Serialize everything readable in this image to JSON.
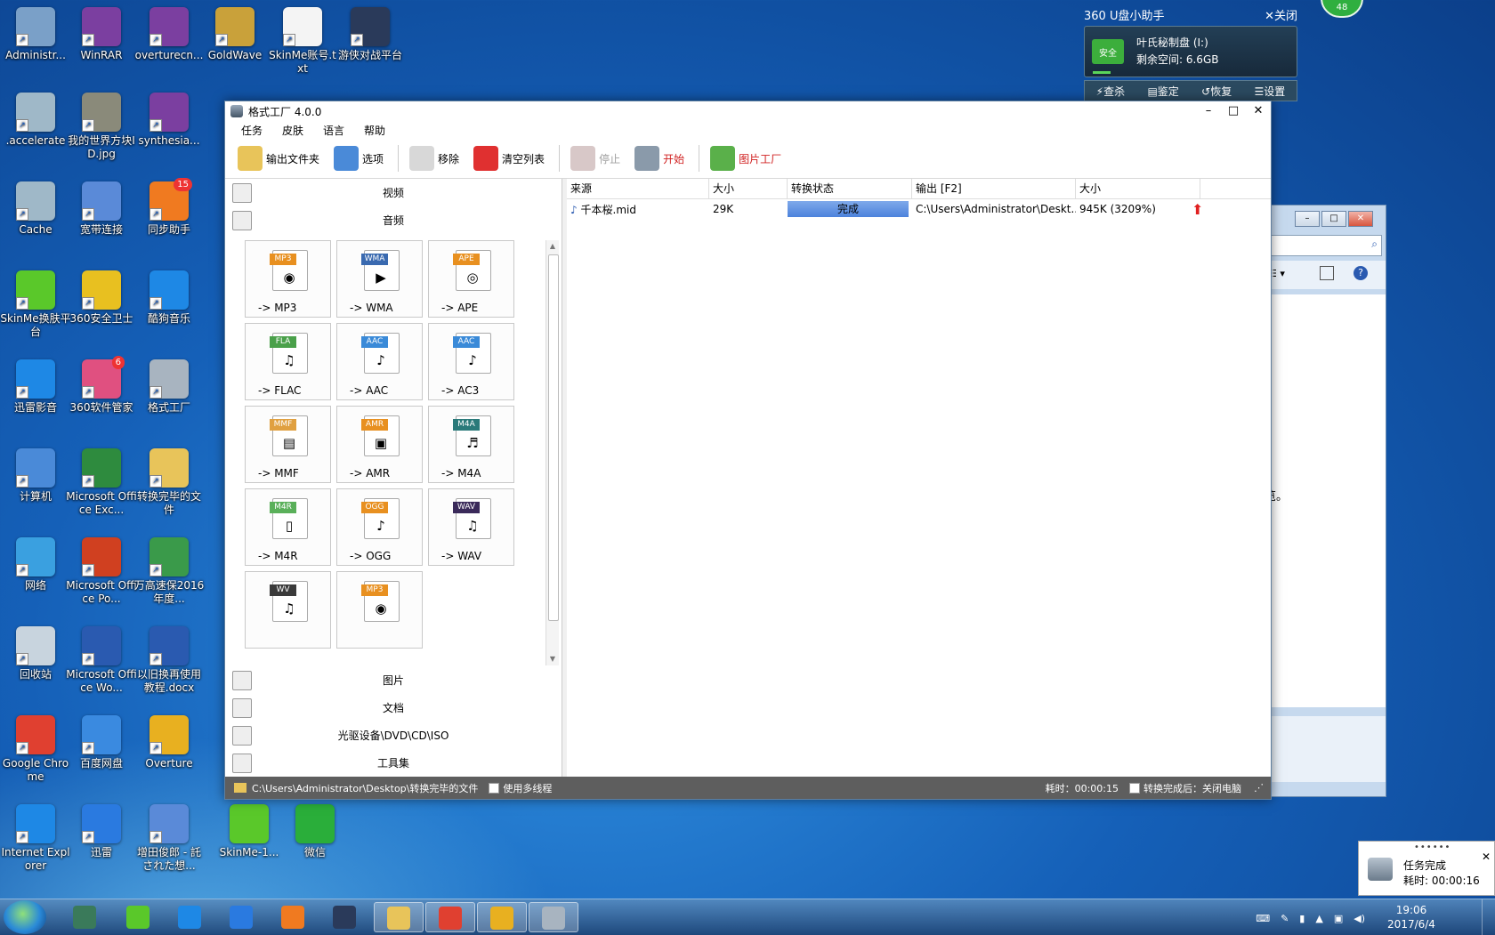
{
  "desktop_icons": [
    {
      "label": "Administr...",
      "color": "#7aa0c8"
    },
    {
      "label": "WinRAR",
      "color": "#7b3fa0"
    },
    {
      "label": "overturecn...",
      "color": "#7b3fa0"
    },
    {
      "label": "GoldWave",
      "color": "#c9a13a"
    },
    {
      "label": "SkinMe账号.txt",
      "color": "#f4f4f4"
    },
    {
      "label": "游侠对战平台",
      "color": "#2a3a5a"
    },
    {
      "label": ".accelerate",
      "color": "#9fb8c8"
    },
    {
      "label": "我的世界方块ID.jpg",
      "color": "#8a8a7a"
    },
    {
      "label": "synthesia...",
      "color": "#7b3fa0"
    },
    {
      "label": "Cache",
      "color": "#9fb8c8"
    },
    {
      "label": "宽带连接",
      "color": "#5a8ad8"
    },
    {
      "label": "同步助手",
      "color": "#f07a20",
      "badge": "15"
    },
    {
      "label": "SkinMe换肤平台",
      "color": "#5ac82a"
    },
    {
      "label": "360安全卫士",
      "color": "#e8c020"
    },
    {
      "label": "酷狗音乐",
      "color": "#1e88e5"
    },
    {
      "label": "迅雷影音",
      "color": "#1e88e5"
    },
    {
      "label": "360软件管家",
      "color": "#e05080",
      "badge": "6"
    },
    {
      "label": "格式工厂",
      "color": "#a8b4c0"
    },
    {
      "label": "计算机",
      "color": "#4a8ad8"
    },
    {
      "label": "Microsoft Office Exc...",
      "color": "#2e8b3e"
    },
    {
      "label": "转换完毕的文件",
      "color": "#e8c45a"
    },
    {
      "label": "网络",
      "color": "#3aa0e0"
    },
    {
      "label": "Microsoft Office Po...",
      "color": "#d04020"
    },
    {
      "label": "万高速保2016年度...",
      "color": "#3a9a4a"
    },
    {
      "label": "回收站",
      "color": "#c8d4de"
    },
    {
      "label": "Microsoft Office Wo...",
      "color": "#2a5ab0"
    },
    {
      "label": "以旧换再使用教程.docx",
      "color": "#2a5ab0"
    },
    {
      "label": "Google Chrome",
      "color": "#e04030"
    },
    {
      "label": "百度网盘",
      "color": "#3a8ae0"
    },
    {
      "label": "Overture",
      "color": "#e8b020"
    },
    {
      "label": "Internet Explorer",
      "color": "#1e88e5"
    },
    {
      "label": "迅雷",
      "color": "#2a7ae0"
    },
    {
      "label": "增田俊郎 - 託された想...",
      "color": "#5a8ad8"
    },
    {
      "label": "SkinMe-1...",
      "color": "#5ac82a"
    },
    {
      "label": "微信",
      "color": "#2aae3a"
    }
  ],
  "u360": {
    "title": "360 U盘小助手",
    "close": "✕关闭",
    "safe": "安全",
    "disk": "叶氏秘制盘 (I:)",
    "space": "剩余空间: 6.6GB",
    "actions": [
      "查杀",
      "鉴定",
      "恢复",
      "设置"
    ],
    "ball": "48"
  },
  "app": {
    "title": "格式工厂 4.0.0",
    "menu": [
      "任务",
      "皮肤",
      "语言",
      "帮助"
    ],
    "toolbar": [
      {
        "label": "输出文件夹",
        "color": "#e8c45a",
        "state": "normal"
      },
      {
        "label": "选项",
        "color": "#4a8ad8",
        "state": "normal"
      },
      {
        "label": "移除",
        "color": "#d8d8d8",
        "state": "normal"
      },
      {
        "label": "清空列表",
        "color": "#e03030",
        "state": "normal"
      },
      {
        "label": "停止",
        "color": "#d8c8c8",
        "state": "disabled"
      },
      {
        "label": "开始",
        "color": "#8a9aaa",
        "state": "red"
      },
      {
        "label": "图片工厂",
        "color": "#5ab04a",
        "state": "red"
      }
    ],
    "categories_top": [
      {
        "label": "视频"
      },
      {
        "label": "音频"
      }
    ],
    "categories_bottom": [
      {
        "label": "图片"
      },
      {
        "label": "文档"
      },
      {
        "label": "光驱设备\\DVD\\CD\\ISO"
      },
      {
        "label": "工具集"
      }
    ],
    "formats": [
      {
        "tag": "MP3",
        "label": "-> MP3",
        "color": "#e89020",
        "glyph": "◉"
      },
      {
        "tag": "WMA",
        "label": "-> WMA",
        "color": "#3a6ab0",
        "glyph": "▶"
      },
      {
        "tag": "APE",
        "label": "-> APE",
        "color": "#e89020",
        "glyph": "◎"
      },
      {
        "tag": "FLA",
        "label": "-> FLAC",
        "color": "#4aa04a",
        "glyph": "♫"
      },
      {
        "tag": "AAC",
        "label": "-> AAC",
        "color": "#3a8ad8",
        "glyph": "♪"
      },
      {
        "tag": "AAC",
        "label": "-> AC3",
        "color": "#3a8ad8",
        "glyph": "♪"
      },
      {
        "tag": "MMF",
        "label": "-> MMF",
        "color": "#e0a040",
        "glyph": "▤"
      },
      {
        "tag": "AMR",
        "label": "-> AMR",
        "color": "#e89020",
        "glyph": "▣"
      },
      {
        "tag": "M4A",
        "label": "-> M4A",
        "color": "#2a7a7a",
        "glyph": "♬"
      },
      {
        "tag": "M4R",
        "label": "-> M4R",
        "color": "#5ab05a",
        "glyph": "▯"
      },
      {
        "tag": "OGG",
        "label": "-> OGG",
        "color": "#e89020",
        "glyph": "♪"
      },
      {
        "tag": "WAV",
        "label": "-> WAV",
        "color": "#3a2a5a",
        "glyph": "♫"
      },
      {
        "tag": "WV",
        "label": "",
        "color": "#3a3a3a",
        "glyph": "♫"
      },
      {
        "tag": "MP3",
        "label": "",
        "color": "#e89020",
        "glyph": "◉"
      }
    ],
    "columns": [
      "来源",
      "大小",
      "转换状态",
      "输出 [F2]",
      "大小"
    ],
    "rows": [
      {
        "source": "千本桜.mid",
        "size": "29K",
        "status": "完成",
        "output": "C:\\Users\\Administrator\\Deskt...",
        "outsize": "945K  (3209%)"
      }
    ],
    "statusbar": {
      "path": "C:\\Users\\Administrator\\Desktop\\转换完毕的文件",
      "multithread": "使用多线程",
      "elapsed": "耗时：00:00:15",
      "after": "转换完成后：关闭电脑"
    }
  },
  "bgwin": {
    "text": "览。"
  },
  "toast": {
    "dots": "••••••",
    "title": "任务完成",
    "time": "耗时: 00:00:16",
    "close": "✕"
  },
  "taskbar": {
    "items": [
      {
        "name": "start",
        "color": "#2a8ad8"
      },
      {
        "name": "monitor",
        "color": "#3a7a5a"
      },
      {
        "name": "skinme",
        "color": "#5ac82a"
      },
      {
        "name": "xunlei-player",
        "color": "#1e88e5"
      },
      {
        "name": "xunlei",
        "color": "#2a7ae0"
      },
      {
        "name": "sync-helper",
        "color": "#f07a20"
      },
      {
        "name": "game",
        "color": "#2a3a5a"
      },
      {
        "name": "explorer",
        "color": "#e8c45a"
      },
      {
        "name": "chrome",
        "color": "#e04030"
      },
      {
        "name": "overture",
        "color": "#e8b020"
      },
      {
        "name": "format-factory",
        "color": "#a8b4c0"
      }
    ],
    "time": "19:06",
    "date": "2017/6/4"
  }
}
